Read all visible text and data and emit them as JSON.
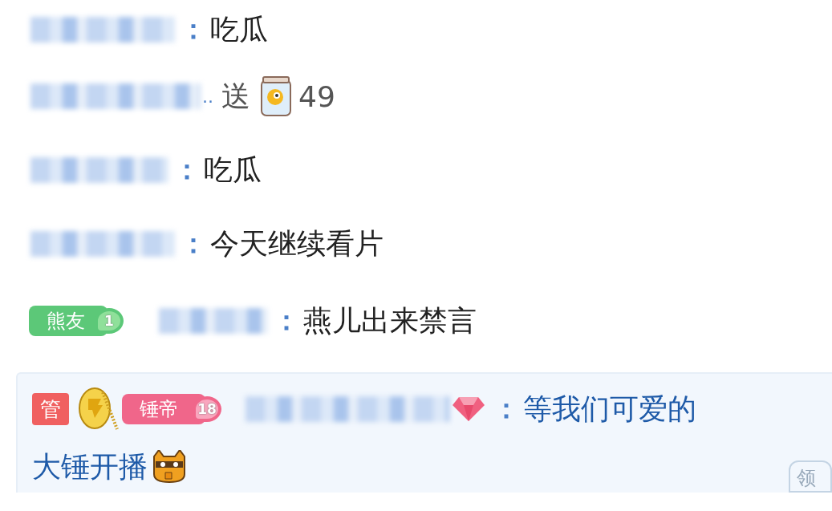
{
  "messages": [
    {
      "kind": "chat",
      "separator": "：",
      "text": "吃瓜"
    },
    {
      "kind": "gift",
      "name_tail": "..",
      "verb": "送",
      "count": "49"
    },
    {
      "kind": "chat",
      "separator": "：",
      "text": "吃瓜"
    },
    {
      "kind": "chat",
      "separator": "：",
      "text": "今天继续看片"
    },
    {
      "kind": "chat",
      "badges": [
        {
          "label": "熊友",
          "level": "1",
          "color": "#5cc878"
        }
      ],
      "separator": "：",
      "text": "燕儿出来禁言"
    },
    {
      "kind": "highlight",
      "admin": "管",
      "medal": true,
      "badges": [
        {
          "label": "锤帝",
          "level": "18",
          "color": "#f0668a"
        }
      ],
      "diamond": true,
      "separator": "：",
      "text": "等我们可爱的",
      "text_continued": "大锤开播",
      "emote": true,
      "corner_label": "领"
    }
  ]
}
